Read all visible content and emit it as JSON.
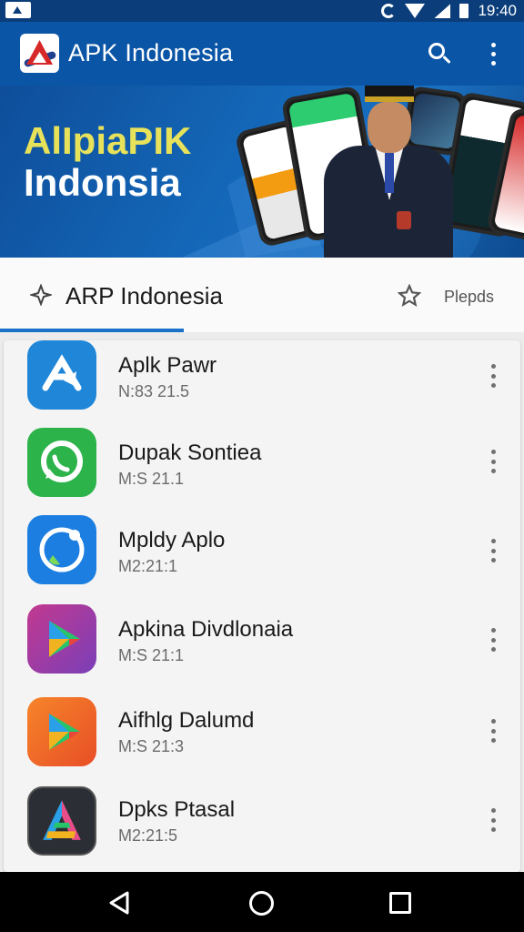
{
  "status_bar": {
    "time": "19:40"
  },
  "app_bar": {
    "title": "APK Indonesia"
  },
  "banner": {
    "title_line1": "AlIpiaPIK",
    "title_line2": "Indonsia"
  },
  "tabs": [
    {
      "label": "ARP Indonesia",
      "icon": "pin-icon",
      "selected": true
    },
    {
      "label": "Plepds",
      "icon": "star-icon",
      "selected": false
    }
  ],
  "apps": [
    {
      "name": "Aplk Pawr",
      "sub": "N:83 21.5",
      "icon": "app-store-arrow-icon",
      "color": "#1f86d8"
    },
    {
      "name": "Dupak Sontiea",
      "sub": "M:S 21.1",
      "icon": "whatsapp-icon",
      "color": "#2cb34a"
    },
    {
      "name": "Mpldy Aplo",
      "sub": "M2:21:1",
      "icon": "refresh-bubble-icon",
      "color": "#1b7ee0"
    },
    {
      "name": "Apkina Divdlonaia",
      "sub": "M:S 21:1",
      "icon": "play-icon",
      "color": "#9b3fb5"
    },
    {
      "name": "Aifhlg Dalumd",
      "sub": "M:S 21:3",
      "icon": "play-icon",
      "color": "#f0622a"
    },
    {
      "name": "Dpks Ptasal",
      "sub": "M2:21:5",
      "icon": "prism-a-icon",
      "color": "#2b2f35"
    }
  ],
  "colors": {
    "primary": "#0b55a6",
    "status": "#0a3d7a",
    "accent": "#1a73c8",
    "nav": "#000000"
  }
}
